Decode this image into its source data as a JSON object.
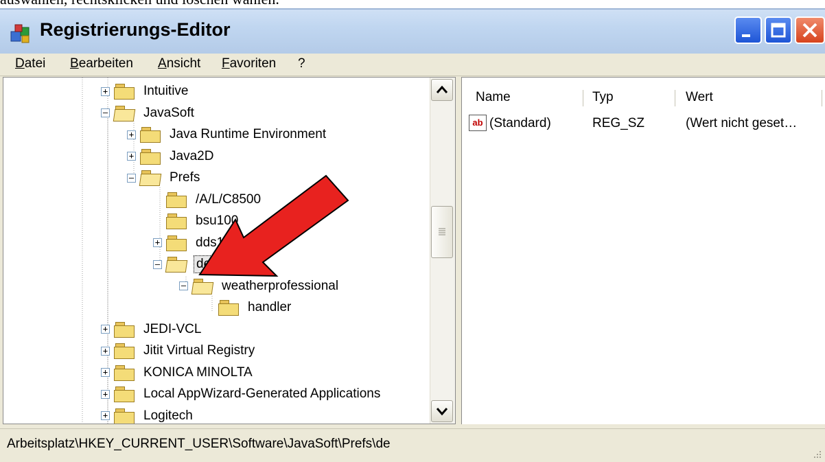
{
  "caption": "auswählen, rechtsklicken und löschen wählen.",
  "window": {
    "title": "Registrierungs-Editor",
    "buttons": {
      "minimize": "minimize",
      "maximize": "maximize",
      "close": "close"
    }
  },
  "menu": [
    "Datei",
    "Bearbeiten",
    "Ansicht",
    "Favoriten",
    "?"
  ],
  "tree": {
    "items": [
      {
        "label": "Intuitive",
        "expander": "+",
        "open": false
      },
      {
        "label": "JavaSoft",
        "expander": "−",
        "open": true
      },
      {
        "label": "Java Runtime Environment",
        "expander": "+",
        "open": false
      },
      {
        "label": "Java2D",
        "expander": "+",
        "open": false
      },
      {
        "label": "Prefs",
        "expander": "−",
        "open": true
      },
      {
        "label": "/A/L/C8500",
        "expander": "",
        "open": false
      },
      {
        "label": "bsu100",
        "expander": "",
        "open": false
      },
      {
        "label": "dds10",
        "expander": "+",
        "open": false
      },
      {
        "label": "de",
        "expander": "−",
        "open": true,
        "selected": true
      },
      {
        "label": "weatherprofessional",
        "expander": "−",
        "open": true
      },
      {
        "label": "handler",
        "expander": "",
        "open": false
      },
      {
        "label": "JEDI-VCL",
        "expander": "+",
        "open": false
      },
      {
        "label": "Jitit Virtual Registry",
        "expander": "+",
        "open": false
      },
      {
        "label": "KONICA MINOLTA",
        "expander": "+",
        "open": false
      },
      {
        "label": "Local AppWizard-Generated Applications",
        "expander": "+",
        "open": false
      },
      {
        "label": "Logitech",
        "expander": "+",
        "open": false
      }
    ]
  },
  "list": {
    "columns": [
      "Name",
      "Typ",
      "Wert"
    ],
    "rows": [
      {
        "name": "(Standard)",
        "type": "REG_SZ",
        "value": "(Wert nicht geset…",
        "icon": "ab-string-icon"
      }
    ]
  },
  "status": {
    "path": "Arbeitsplatz\\HKEY_CURRENT_USER\\Software\\JavaSoft\\Prefs\\de"
  },
  "colors": {
    "arrow": "#e8221f",
    "title_gradient": "#c0d6f0"
  }
}
